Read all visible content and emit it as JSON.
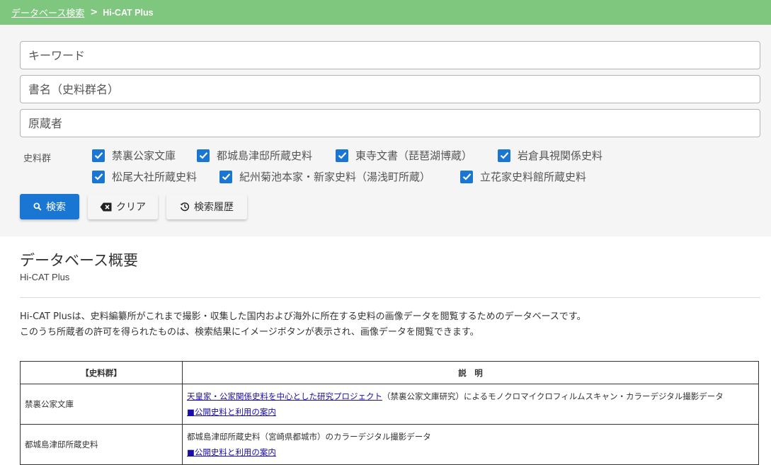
{
  "breadcrumb": {
    "parent": "データベース検索",
    "separator": ">",
    "current": "Hi-CAT Plus"
  },
  "search": {
    "keyword_placeholder": "キーワード",
    "title_placeholder": "書名（史料群名）",
    "owner_placeholder": "原蔵者",
    "collections_label": "史料群",
    "collections": [
      {
        "label": "禁裏公家文庫",
        "checked": true
      },
      {
        "label": "都城島津邸所蔵史料",
        "checked": true
      },
      {
        "label": "東寺文書（琵琶湖博蔵）",
        "checked": true
      },
      {
        "label": "岩倉具視関係史料",
        "checked": true
      },
      {
        "label": "松尾大社所蔵史料",
        "checked": true
      },
      {
        "label": "紀州菊池本家・新家史料（湯浅町所蔵）",
        "checked": true
      },
      {
        "label": "立花家史料館所蔵史料",
        "checked": true
      }
    ],
    "search_button": "検索",
    "clear_button": "クリア",
    "history_button": "検索履歴"
  },
  "overview": {
    "title": "データベース概要",
    "subtitle": "Hi-CAT Plus",
    "description_1": "Hi-CAT Plusは、史料編纂所がこれまで撮影・収集した国内および海外に所在する史料の画像データを閲覧するためのデータベースです。",
    "description_2": "このうち所蔵者の許可を得られたものは、検索結果にイメージボタンが表示され、画像データを閲覧できます。"
  },
  "table": {
    "header_collection": "【史料群】",
    "header_description": "説　明",
    "rows": [
      {
        "name": "禁裏公家文庫",
        "link": "天皇家・公家関係史料を中心とした研究プロジェクト",
        "text": "（禁裏公家文庫研究）によるモノクロマイクロフィルムスキャン・カラーデジタル撮影データ",
        "guide": "■公開史料と利用の案内"
      },
      {
        "name": "都城島津邸所蔵史料",
        "link": "",
        "text": "都城島津邸所蔵史料（宮崎県都城市）のカラーデジタル撮影データ",
        "guide": "■公開史料と利用の案内"
      }
    ]
  },
  "colors": {
    "topbar": "#7fc77f",
    "primary": "#1976d2",
    "panel": "#f5f5f5"
  }
}
